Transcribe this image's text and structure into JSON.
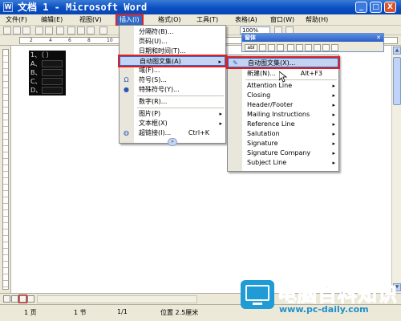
{
  "window": {
    "title": "文档 1 - Microsoft Word",
    "minimize": "_",
    "maximize": "□",
    "close": "X"
  },
  "menubar": [
    {
      "label": "文件(F)"
    },
    {
      "label": "编辑(E)"
    },
    {
      "label": "视图(V)"
    },
    {
      "label": "插入(I)"
    },
    {
      "label": "格式(O)"
    },
    {
      "label": "工具(T)"
    },
    {
      "label": "表格(A)"
    },
    {
      "label": "窗口(W)"
    },
    {
      "label": "帮助(H)"
    }
  ],
  "toolbar": {
    "zoom": "100%"
  },
  "ruler": {
    "ticks": [
      "2",
      "4",
      "6",
      "8",
      "10"
    ]
  },
  "document": {
    "lines": [
      "1、（ ）",
      "A、",
      "B、",
      "C、",
      "D、"
    ]
  },
  "insert_menu": {
    "items": [
      {
        "label": "分隔符(B)...",
        "shortcut": "",
        "submenu": false
      },
      {
        "label": "页码(U)...",
        "shortcut": "",
        "submenu": false
      },
      {
        "label": "日期和时间(T)...",
        "shortcut": "",
        "submenu": false
      },
      {
        "label": "自动图文集(A)",
        "shortcut": "",
        "submenu": true,
        "highlighted": true
      },
      {
        "label": "域(F)...",
        "shortcut": "",
        "submenu": false
      },
      {
        "label": "符号(S)...",
        "shortcut": "",
        "submenu": false
      },
      {
        "label": "特殊符号(Y)...",
        "shortcut": "",
        "submenu": false
      },
      {
        "label": "数字(R)...",
        "shortcut": "",
        "submenu": false
      },
      {
        "label": "图片(P)",
        "shortcut": "",
        "submenu": true
      },
      {
        "label": "文本框(X)",
        "shortcut": "",
        "submenu": true
      },
      {
        "label": "超链接(I)...",
        "shortcut": "Ctrl+K",
        "submenu": false
      }
    ],
    "more": "»"
  },
  "autotext_submenu": {
    "items": [
      {
        "label": "自动图文集(X)...",
        "shortcut": "",
        "submenu": false,
        "highlighted": true
      },
      {
        "label": "新建(N)...",
        "shortcut": "Alt+F3",
        "submenu": false
      },
      {
        "label": "Attention Line",
        "shortcut": "",
        "submenu": true
      },
      {
        "label": "Closing",
        "shortcut": "",
        "submenu": true
      },
      {
        "label": "Header/Footer",
        "shortcut": "",
        "submenu": true
      },
      {
        "label": "Mailing Instructions",
        "shortcut": "",
        "submenu": true
      },
      {
        "label": "Reference Line",
        "shortcut": "",
        "submenu": true
      },
      {
        "label": "Salutation",
        "shortcut": "",
        "submenu": true
      },
      {
        "label": "Signature",
        "shortcut": "",
        "submenu": true
      },
      {
        "label": "Signature Company",
        "shortcut": "",
        "submenu": true
      },
      {
        "label": "Subject Line",
        "shortcut": "",
        "submenu": true
      }
    ]
  },
  "autotext_toolbar": {
    "caption": "窗体",
    "button_label": "abl"
  },
  "statusbar": {
    "page": "1 页",
    "section": "1 节",
    "page_of": "1/1",
    "position": "位置 2.5厘米"
  },
  "watermark": {
    "title": "电脑百科知识",
    "url": "www.pc-daily.com"
  },
  "colors": {
    "menu_highlight_outline": "#e02020",
    "title_bar": "#0a4fc4",
    "watermark": "#1f8fca"
  }
}
